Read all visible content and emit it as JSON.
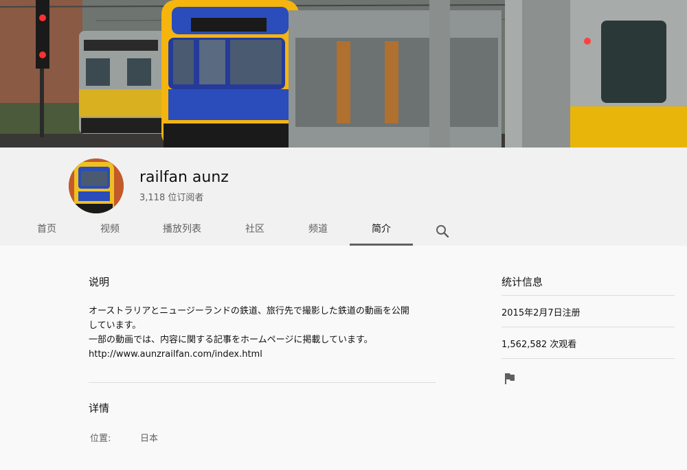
{
  "channel": {
    "name": "railfan aunz",
    "subscribers": "3,118 位订阅者"
  },
  "tabs": [
    {
      "label": "首页"
    },
    {
      "label": "视频"
    },
    {
      "label": "播放列表"
    },
    {
      "label": "社区"
    },
    {
      "label": "频道"
    },
    {
      "label": "简介",
      "active": true
    }
  ],
  "description": {
    "title": "说明",
    "lines": [
      "オーストラリアとニュージーランドの鉄道、旅行先で撮影した鉄道の動画を公開",
      "しています。",
      "一部の動画では、内容に関する記事をホームページに掲載しています。",
      "http://www.aunzrailfan.com/index.html"
    ]
  },
  "details": {
    "title": "详情",
    "location_label": "位置:",
    "location_value": "日本"
  },
  "stats": {
    "title": "统计信息",
    "joined": "2015年2月7日注册",
    "views": "1,562,582 次观看"
  },
  "icons": {
    "search": "search-icon",
    "flag": "flag-icon"
  },
  "colors": {
    "header_bg": "#f1f1f1",
    "page_bg": "#f9f9f9",
    "tab_underline": "#606060",
    "train_yellow": "#f5b50e",
    "train_blue": "#2a4dbb"
  }
}
